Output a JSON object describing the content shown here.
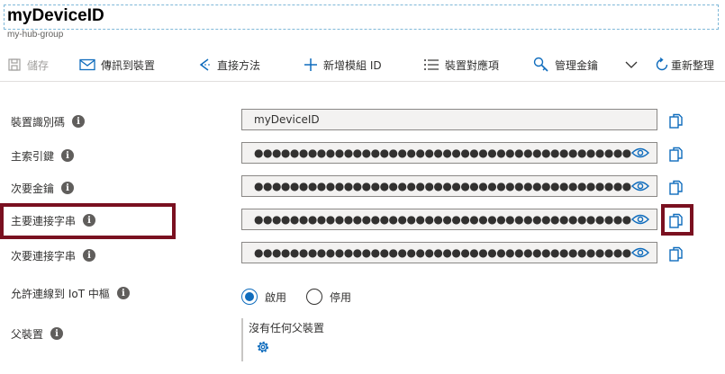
{
  "header": {
    "title": "myDeviceID",
    "subtitle": "my-hub-group"
  },
  "toolbar": {
    "save": "儲存",
    "send_message": "傳訊到裝置",
    "direct_method": "直接方法",
    "add_module": "新增模組 ID",
    "device_twin": "裝置對應項",
    "manage_keys": "管理金鑰",
    "refresh": "重新整理"
  },
  "fields": {
    "device_id": {
      "label": "裝置識別碼",
      "value": "myDeviceID"
    },
    "primary_key": {
      "label": "主索引鍵",
      "value": "●●●●●●●●●●●●●●●●●●●●●●●●●●●●●●●●●●●●●●●●●●●●"
    },
    "secondary_key": {
      "label": "次要金鑰",
      "value": "●●●●●●●●●●●●●●●●●●●●●●●●●●●●●●●●●●●●●●●●●●●●"
    },
    "primary_conn": {
      "label": "主要連接字串",
      "value": "●●●●●●●●●●●●●●●●●●●●●●●●●●●●●●●●●●●●●●●●●●●●●●●●●●●●●●●●●●●●●●●●●●●●●●●●●●●●●●●●●●●●●●●●●●●●●●"
    },
    "secondary_conn": {
      "label": "次要連接字串",
      "value": "●●●●●●●●●●●●●●●●●●●●●●●●●●●●●●●●●●●●●●●●●●●●●●●●●●●●●●●●●●●●●●●●●●●●●●●●●●●●●●●●●●●●●●●●●●●●●●"
    }
  },
  "connection": {
    "label": "允許連線到 IoT 中樞",
    "options": [
      "啟用",
      "停用"
    ],
    "selected": "啟用"
  },
  "parent": {
    "label": "父裝置",
    "value": "沒有任何父裝置"
  },
  "info_glyph": "i",
  "colors": {
    "accent": "#0f6cbd",
    "highlight": "#7a1020",
    "field_bg": "#f3f2f1"
  }
}
